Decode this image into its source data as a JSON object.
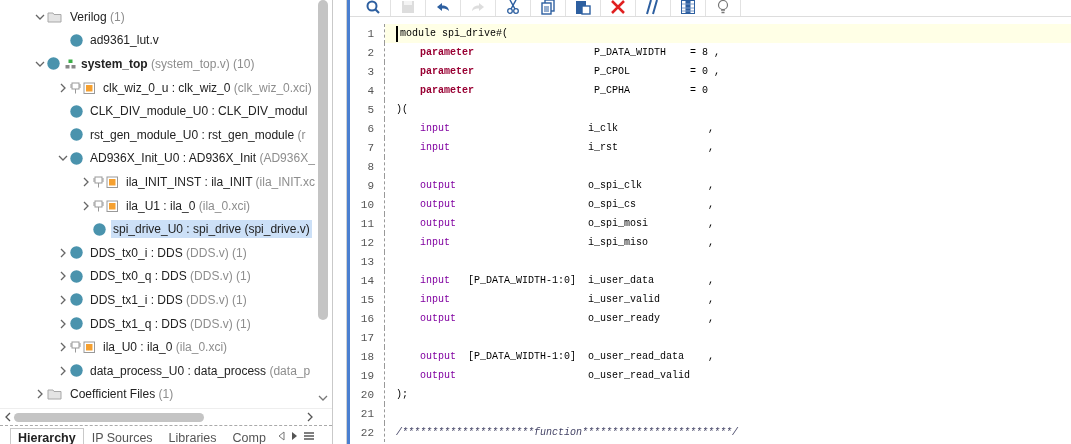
{
  "tree": [
    {
      "name": "Verilog",
      "detail": "(1)",
      "kind": "folder",
      "expanded": true,
      "selected": false,
      "children": [
        {
          "name": "ad9361_lut.v",
          "kind": "source",
          "selected": false
        }
      ]
    },
    {
      "name": "system_top",
      "detail": "(system_top.v) (10)",
      "kind": "top",
      "expanded": true,
      "selected": false,
      "children": [
        {
          "name": "clk_wiz_0_u : clk_wiz_0",
          "detail": "(clk_wiz_0.xci)",
          "kind": "ip",
          "expanded": false,
          "selected": false
        },
        {
          "name": "CLK_DIV_module_U0 : CLK_DIV_modul",
          "kind": "source",
          "selected": false
        },
        {
          "name": "rst_gen_module_U0 : rst_gen_module",
          "detail": "(r",
          "kind": "source",
          "selected": false
        },
        {
          "name": "AD936X_Init_U0 : AD936X_Init",
          "detail": "(AD936X_",
          "kind": "source",
          "expanded": true,
          "selected": false,
          "children": [
            {
              "name": "ila_INIT_INST : ila_INIT",
              "detail": "(ila_INIT.xc",
              "kind": "ip",
              "expanded": false,
              "selected": false
            },
            {
              "name": "ila_U1 : ila_0",
              "detail": "(ila_0.xci)",
              "kind": "ip",
              "expanded": false,
              "selected": false
            },
            {
              "name": "spi_drive_U0 : spi_drive (spi_drive.v)",
              "kind": "source",
              "selected": true
            }
          ]
        },
        {
          "name": "DDS_tx0_i : DDS",
          "detail": "(DDS.v) (1)",
          "kind": "source",
          "expanded": false,
          "selected": false
        },
        {
          "name": "DDS_tx0_q : DDS",
          "detail": "(DDS.v) (1)",
          "kind": "source",
          "expanded": false,
          "selected": false
        },
        {
          "name": "DDS_tx1_i : DDS",
          "detail": "(DDS.v) (1)",
          "kind": "source",
          "expanded": false,
          "selected": false
        },
        {
          "name": "DDS_tx1_q : DDS",
          "detail": "(DDS.v) (1)",
          "kind": "source",
          "expanded": false,
          "selected": false
        },
        {
          "name": "ila_U0 : ila_0",
          "detail": "(ila_0.xci)",
          "kind": "ip",
          "expanded": false,
          "selected": false
        },
        {
          "name": "data_process_U0 : data_process",
          "detail": "(data_p",
          "kind": "source",
          "expanded": false,
          "selected": false
        }
      ]
    },
    {
      "name": "Coefficient Files",
      "detail": "(1)",
      "kind": "folder",
      "expanded": false,
      "selected": false
    }
  ],
  "panel_tabs": [
    {
      "label": "Hierarchy",
      "selected": true
    },
    {
      "label": "IP Sources",
      "selected": false
    },
    {
      "label": "Libraries",
      "selected": false
    },
    {
      "label": "Comp",
      "selected": false
    }
  ],
  "toolbar": [
    {
      "kind": "search",
      "disabled": false
    },
    {
      "kind": "save",
      "disabled": true
    },
    {
      "kind": "undo",
      "disabled": false
    },
    {
      "kind": "redo",
      "disabled": true
    },
    {
      "kind": "cut",
      "disabled": false
    },
    {
      "kind": "copy",
      "disabled": false
    },
    {
      "kind": "paste",
      "disabled": false
    },
    {
      "kind": "delete",
      "disabled": false
    },
    {
      "kind": "comment",
      "disabled": false
    },
    {
      "kind": "columns",
      "disabled": false
    },
    {
      "kind": "bulb",
      "disabled": false
    }
  ],
  "code": [
    {
      "number": "1",
      "current": true,
      "indented": false,
      "tokens": [
        {
          "text": "module spi_drive#(",
          "kind": "plain"
        }
      ]
    },
    {
      "number": "2",
      "current": false,
      "indented": true,
      "tokens": [
        {
          "text": "parameter",
          "kind": "keyword"
        },
        {
          "text": "                    P_DATA_WIDTH    = 8 ,",
          "kind": "plain"
        }
      ]
    },
    {
      "number": "3",
      "current": false,
      "indented": true,
      "tokens": [
        {
          "text": "parameter",
          "kind": "keyword"
        },
        {
          "text": "                    P_CPOL          = 0 ,",
          "kind": "plain"
        }
      ]
    },
    {
      "number": "4",
      "current": false,
      "indented": true,
      "tokens": [
        {
          "text": "parameter",
          "kind": "keyword"
        },
        {
          "text": "                    P_CPHA          = 0",
          "kind": "plain"
        }
      ]
    },
    {
      "number": "5",
      "current": false,
      "indented": false,
      "tokens": [
        {
          "text": ")(",
          "kind": "plain"
        }
      ]
    },
    {
      "number": "6",
      "current": false,
      "indented": true,
      "tokens": [
        {
          "text": "input",
          "kind": "port"
        },
        {
          "text": "                       i_clk               ,",
          "kind": "plain"
        }
      ]
    },
    {
      "number": "7",
      "current": false,
      "indented": true,
      "tokens": [
        {
          "text": "input",
          "kind": "port"
        },
        {
          "text": "                       i_rst               ,",
          "kind": "plain"
        }
      ]
    },
    {
      "number": "8",
      "current": false
    },
    {
      "number": "9",
      "current": false,
      "indented": true,
      "tokens": [
        {
          "text": "output",
          "kind": "port"
        },
        {
          "text": "                      o_spi_clk           ,",
          "kind": "plain"
        }
      ]
    },
    {
      "number": "10",
      "current": false,
      "indented": true,
      "tokens": [
        {
          "text": "output",
          "kind": "port"
        },
        {
          "text": "                      o_spi_cs            ,",
          "kind": "plain"
        }
      ]
    },
    {
      "number": "11",
      "current": false,
      "indented": true,
      "tokens": [
        {
          "text": "output",
          "kind": "port"
        },
        {
          "text": "                      o_spi_mosi          ,",
          "kind": "plain"
        }
      ]
    },
    {
      "number": "12",
      "current": false,
      "indented": true,
      "tokens": [
        {
          "text": "input",
          "kind": "port"
        },
        {
          "text": "                       i_spi_miso          ,",
          "kind": "plain"
        }
      ]
    },
    {
      "number": "13",
      "current": false
    },
    {
      "number": "14",
      "current": false,
      "indented": true,
      "tokens": [
        {
          "text": "input",
          "kind": "port"
        },
        {
          "text": "   [P_DATA_WIDTH-1:0]  i_user_data         ,",
          "kind": "plain"
        }
      ]
    },
    {
      "number": "15",
      "current": false,
      "indented": true,
      "tokens": [
        {
          "text": "input",
          "kind": "port"
        },
        {
          "text": "                       i_user_valid        ,",
          "kind": "plain"
        }
      ]
    },
    {
      "number": "16",
      "current": false,
      "indented": true,
      "tokens": [
        {
          "text": "output",
          "kind": "port"
        },
        {
          "text": "                      o_user_ready        ,",
          "kind": "plain"
        }
      ]
    },
    {
      "number": "17",
      "current": false
    },
    {
      "number": "18",
      "current": false,
      "indented": true,
      "tokens": [
        {
          "text": "output",
          "kind": "port"
        },
        {
          "text": "  [P_DATA_WIDTH-1:0]  o_user_read_data    ,",
          "kind": "plain"
        }
      ]
    },
    {
      "number": "19",
      "current": false,
      "indented": true,
      "tokens": [
        {
          "text": "output",
          "kind": "port"
        },
        {
          "text": "                      o_user_read_valid",
          "kind": "plain"
        }
      ]
    },
    {
      "number": "20",
      "current": false,
      "indented": false,
      "tokens": [
        {
          "text": ");",
          "kind": "plain"
        }
      ]
    },
    {
      "number": "21",
      "current": false
    },
    {
      "number": "22",
      "current": false,
      "indented": false,
      "tokens": [
        {
          "text": "/**********************function*************************/",
          "kind": "comment"
        }
      ]
    }
  ]
}
